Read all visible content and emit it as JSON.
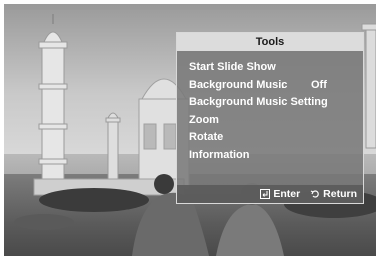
{
  "tools": {
    "title": "Tools",
    "items": [
      {
        "label": "Start Slide Show"
      },
      {
        "label": "Background Music",
        "separator": ":",
        "value": "Off"
      },
      {
        "label": "Background Music Setting"
      },
      {
        "label": "Zoom"
      },
      {
        "label": "Rotate"
      },
      {
        "label": "Information"
      }
    ],
    "footer": {
      "enter": {
        "icon": "enter-icon",
        "label": "Enter"
      },
      "return": {
        "icon": "return-icon",
        "label": "Return"
      }
    }
  }
}
